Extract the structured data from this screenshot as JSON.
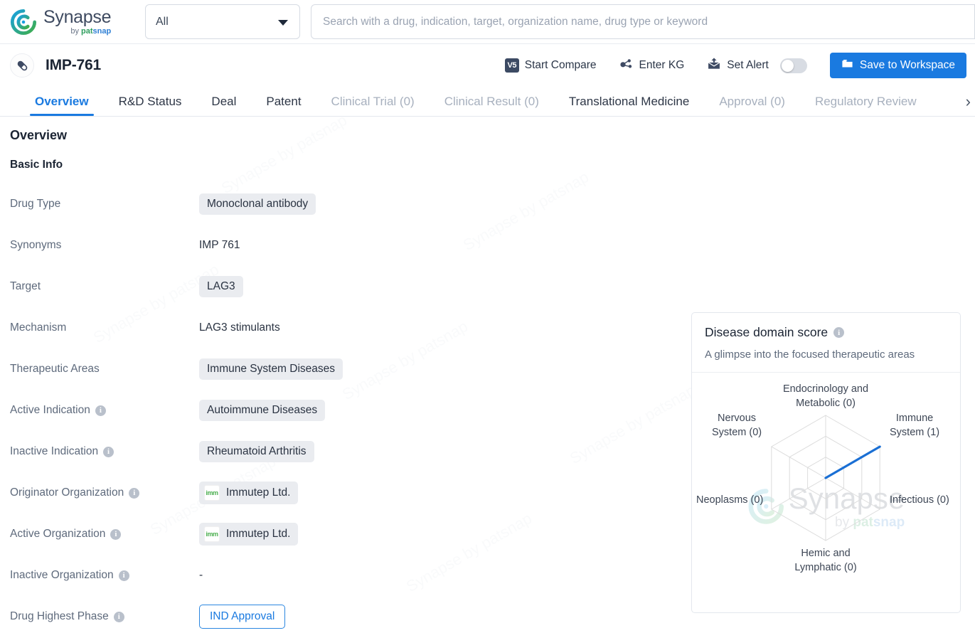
{
  "brand": {
    "name": "Synapse",
    "by": "by ",
    "pat": "pat",
    "snap": "snap",
    "logo_icon": "synapse-logo-icon"
  },
  "topbar": {
    "scope_value": "All",
    "scope_caret_icon": "chevron-down-icon",
    "search_placeholder": "Search with a drug, indication, target, organization name, drug type or keyword",
    "search_value": ""
  },
  "drug_header": {
    "pill_icon": "capsule-icon",
    "title": "IMP-761",
    "actions": {
      "start_compare": "Start Compare",
      "start_compare_icon": "v5-badge-icon",
      "v5_label": "V5",
      "enter_kg": "Enter KG",
      "enter_kg_icon": "knowledge-graph-icon",
      "set_alert": "Set Alert",
      "set_alert_icon": "alert-bell-icon",
      "alert_toggle_state": "off",
      "save_workspace": "Save to Workspace",
      "save_workspace_icon": "folder-icon"
    }
  },
  "tabs": {
    "items": [
      {
        "label": "Overview",
        "state": "active"
      },
      {
        "label": "R&D Status",
        "state": "normal"
      },
      {
        "label": "Deal",
        "state": "normal"
      },
      {
        "label": "Patent",
        "state": "normal"
      },
      {
        "label": "Clinical Trial (0)",
        "state": "dim"
      },
      {
        "label": "Clinical Result (0)",
        "state": "dim"
      },
      {
        "label": "Translational Medicine",
        "state": "normal"
      },
      {
        "label": "Approval (0)",
        "state": "dim"
      },
      {
        "label": "Regulatory Review",
        "state": "dim"
      }
    ],
    "overflow_icon": "chevron-right-icon",
    "overflow_glyph": "›"
  },
  "overview": {
    "section_title": "Overview",
    "subsection_title": "Basic Info",
    "rows": [
      {
        "label": "Drug Type",
        "info": false,
        "kind": "chip",
        "value": "Monoclonal antibody"
      },
      {
        "label": "Synonyms",
        "info": false,
        "kind": "plain",
        "value": "IMP 761"
      },
      {
        "label": "Target",
        "info": false,
        "kind": "chip",
        "value": "LAG3"
      },
      {
        "label": "Mechanism",
        "info": false,
        "kind": "plain",
        "value": "LAG3 stimulants"
      },
      {
        "label": "Therapeutic Areas",
        "info": false,
        "kind": "chip",
        "value": "Immune System Diseases"
      },
      {
        "label": "Active Indication",
        "info": true,
        "kind": "chip",
        "value": "Autoimmune Diseases"
      },
      {
        "label": "Inactive Indication",
        "info": true,
        "kind": "chip",
        "value": "Rheumatoid Arthritis"
      },
      {
        "label": "Originator Organization",
        "info": true,
        "kind": "org",
        "value": "Immutep Ltd.",
        "logo": "imm"
      },
      {
        "label": "Active Organization",
        "info": true,
        "kind": "org",
        "value": "Immutep Ltd.",
        "logo": "imm"
      },
      {
        "label": "Inactive Organization",
        "info": true,
        "kind": "plain",
        "value": "-"
      },
      {
        "label": "Drug Highest Phase",
        "info": true,
        "kind": "phase",
        "value": "IND Approval"
      }
    ],
    "info_glyph": "i"
  },
  "disease_panel": {
    "title": "Disease domain score",
    "title_info_icon": "info-icon",
    "subtitle": "A glimpse into the focused therapeutic areas",
    "watermark_name": "Synapse",
    "watermark_by": "by ",
    "watermark_pat": "pat",
    "watermark_snap": "snap"
  },
  "chart_data": {
    "type": "radar",
    "title": "Disease domain score",
    "subtitle": "A glimpse into the focused therapeutic areas",
    "categories": [
      "Endocrinology and Metabolic (0)",
      "Immune System (1)",
      "Infectious (0)",
      "Hemic and Lymphatic (0)",
      "Neoplasms (0)",
      "Nervous System (0)"
    ],
    "category_names": [
      "Endocrinology and Metabolic",
      "Immune System",
      "Infectious",
      "Hemic and Lymphatic",
      "Neoplasms",
      "Nervous System"
    ],
    "values": [
      0,
      1,
      0,
      0,
      0,
      0
    ],
    "rmax": 1,
    "rings": 3,
    "grid": true,
    "legend": "none",
    "series_color": "#1a6fd4",
    "grid_color": "#dcdcdc"
  },
  "colors": {
    "accent": "#1a7ae0",
    "text_dark": "#1b2433",
    "text_muted": "#5e6a7c",
    "chip_bg": "#eaecf0",
    "dim_tab": "#a7b0be"
  }
}
